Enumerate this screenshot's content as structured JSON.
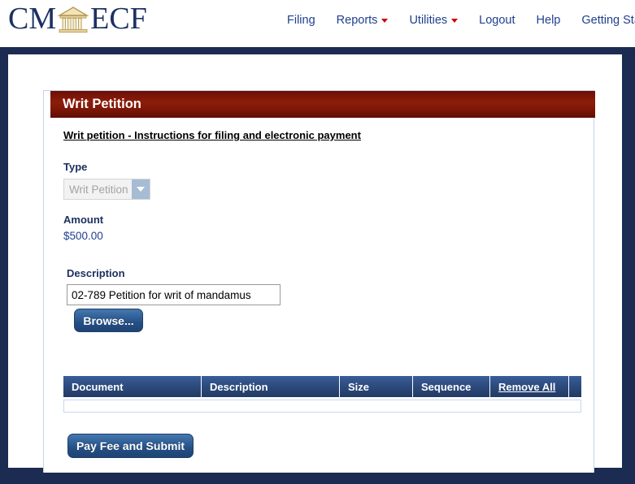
{
  "brand": {
    "text_left": "CM",
    "text_right": "ECF",
    "icon": "courthouse-icon"
  },
  "nav": {
    "items": [
      {
        "label": "Filing",
        "caret": false
      },
      {
        "label": "Reports",
        "caret": true
      },
      {
        "label": "Utilities",
        "caret": true
      },
      {
        "label": "Logout",
        "caret": false
      },
      {
        "label": "Help",
        "caret": false
      },
      {
        "label": "Getting Started",
        "caret": false
      }
    ],
    "caret_color": "#cc0000",
    "link_color": "#1f3f8f"
  },
  "panel": {
    "title": "Writ Petition",
    "header_color": "#7a1607",
    "instructions_link": "Writ petition - Instructions for filing and electronic payment"
  },
  "form": {
    "type": {
      "label": "Type",
      "value": "Writ Petition",
      "disabled": true,
      "options": [
        "Writ Petition"
      ]
    },
    "amount": {
      "label": "Amount",
      "value": "$500.00"
    },
    "description": {
      "label": "Description",
      "value": "02-789 Petition for writ of mandamus",
      "placeholder": ""
    },
    "browse_label": "Browse...",
    "submit_label": "Pay Fee and Submit"
  },
  "files_table": {
    "columns": [
      {
        "label": "Document",
        "link": false
      },
      {
        "label": "Description",
        "link": false
      },
      {
        "label": "Size",
        "link": false
      },
      {
        "label": "Sequence",
        "link": false
      },
      {
        "label": "Remove All",
        "link": true
      }
    ],
    "rows": []
  },
  "colors": {
    "frame_navy": "#1b2b52",
    "button_blue": "#2c5a8f",
    "header_red": "#7a1607",
    "label_navy": "#1c3160"
  }
}
